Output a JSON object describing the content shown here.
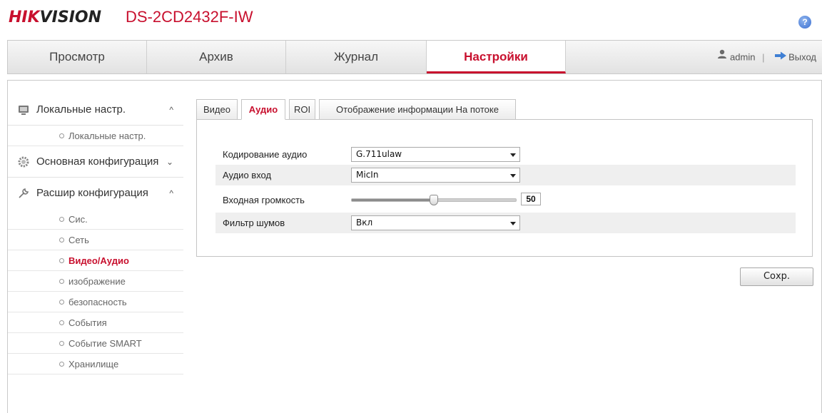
{
  "header": {
    "logo_part1": "HIK",
    "logo_part2": "VISION",
    "model": "DS-2CD2432F-IW",
    "help_icon": "help-icon",
    "help_glyph": "?"
  },
  "topnav": {
    "tabs": [
      {
        "label": "Просмотр"
      },
      {
        "label": "Архив"
      },
      {
        "label": "Журнал"
      },
      {
        "label": "Настройки",
        "active": true
      }
    ],
    "user": "admin",
    "separator": "|",
    "logout": "Выход"
  },
  "sidebar": {
    "groups": [
      {
        "label": "Локальные настр.",
        "icon": "monitor-icon",
        "chevron": "^",
        "items": [
          {
            "label": "Локальные настр."
          }
        ]
      },
      {
        "label": "Основная конфигурация",
        "icon": "gear-icon",
        "chevron": "⌄"
      },
      {
        "label": "Расшир конфигурация",
        "icon": "wrench-icon",
        "chevron": "^",
        "items": [
          {
            "label": "Сис."
          },
          {
            "label": "Сеть"
          },
          {
            "label": "Видео/Аудио",
            "active": true
          },
          {
            "label": "изображение"
          },
          {
            "label": "безопасность"
          },
          {
            "label": "События"
          },
          {
            "label": "Событие SMART"
          },
          {
            "label": "Хранилище"
          }
        ]
      }
    ]
  },
  "tabs": [
    {
      "label": "Видео"
    },
    {
      "label": "Аудио",
      "active": true
    },
    {
      "label": "ROI"
    },
    {
      "label": "Отображение информации На потоке"
    }
  ],
  "form": {
    "audio_encoding": {
      "label": "Кодирование аудио",
      "value": "G.711ulaw"
    },
    "audio_input": {
      "label": "Аудио вход",
      "value": "MicIn"
    },
    "input_volume": {
      "label": "Входная громкость",
      "value": "50",
      "fraction": 0.5
    },
    "noise_filter": {
      "label": "Фильтр шумов",
      "value": "Вкл"
    }
  },
  "save_label": "Сохр.",
  "colors": {
    "accent": "#c8102e",
    "row_alt": "#efefef"
  }
}
